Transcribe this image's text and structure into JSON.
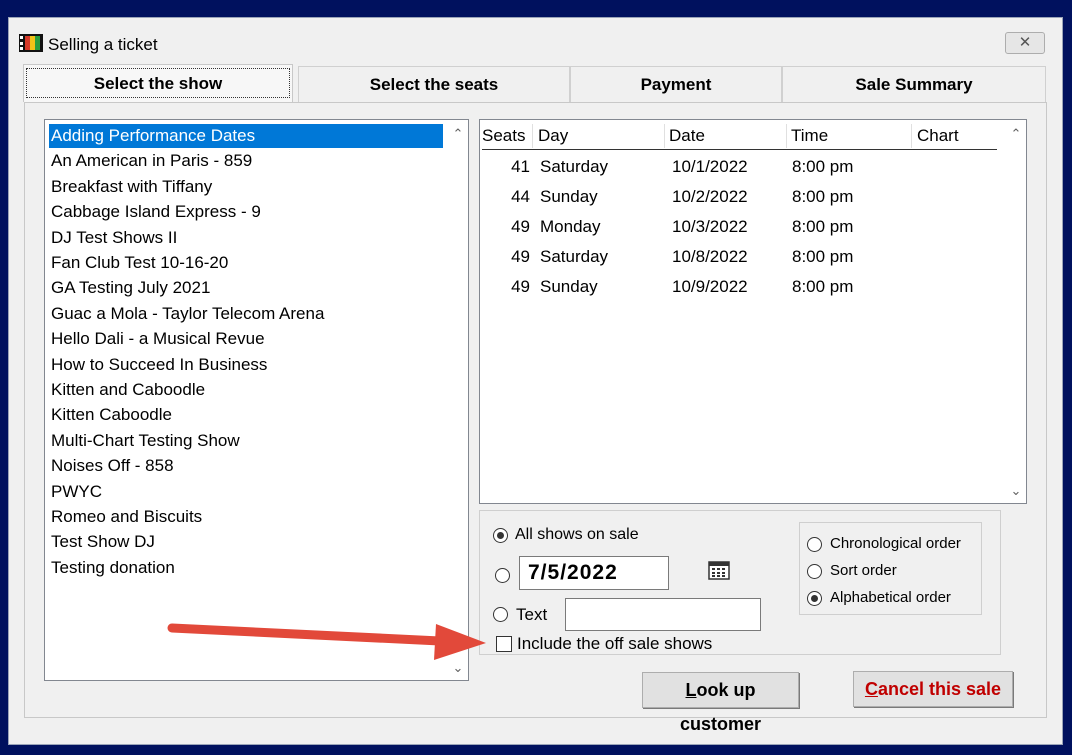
{
  "window": {
    "title": "Selling a ticket",
    "close_glyph": "✕"
  },
  "tabs": [
    {
      "label": "Select the show"
    },
    {
      "label": "Select the seats"
    },
    {
      "label": "Payment"
    },
    {
      "label": "Sale Summary"
    }
  ],
  "shows": [
    "Adding Performance Dates",
    "An American in Paris - 859",
    "Breakfast with Tiffany",
    "Cabbage Island Express - 9",
    "DJ Test Shows II",
    "Fan Club Test 10-16-20",
    "GA Testing July 2021",
    "Guac a Mola - Taylor Telecom Arena",
    "Hello Dali - a Musical Revue",
    "How to Succeed In Business",
    "Kitten and Caboodle",
    "Kitten Caboodle",
    "Multi-Chart Testing Show",
    "Noises Off - 858",
    "PWYC",
    "Romeo and Biscuits",
    "Test Show DJ",
    "Testing donation"
  ],
  "performances": {
    "columns": [
      "Seats",
      "Day",
      "Date",
      "Time",
      "Chart"
    ],
    "rows": [
      {
        "seats": "41",
        "day": "Saturday",
        "date": "10/1/2022",
        "time": "8:00 pm",
        "chart": ""
      },
      {
        "seats": "44",
        "day": "Sunday",
        "date": "10/2/2022",
        "time": "8:00 pm",
        "chart": ""
      },
      {
        "seats": "49",
        "day": "Monday",
        "date": "10/3/2022",
        "time": "8:00 pm",
        "chart": ""
      },
      {
        "seats": "49",
        "day": "Saturday",
        "date": "10/8/2022",
        "time": "8:00 pm",
        "chart": ""
      },
      {
        "seats": "49",
        "day": "Sunday",
        "date": "10/9/2022",
        "time": "8:00 pm",
        "chart": ""
      }
    ]
  },
  "filter": {
    "all_shows_label": "All shows on sale",
    "date_value": "7/5/2022",
    "text_label": "Text",
    "text_value": "",
    "include_off_sale_label": "Include the off sale shows"
  },
  "order": {
    "chronological_label": "Chronological order",
    "sort_label": "Sort order",
    "alphabetical_label": "Alphabetical order"
  },
  "buttons": {
    "lookup_mnemonic": "L",
    "lookup_rest": "ook up customer",
    "cancel_mnemonic": "C",
    "cancel_rest": "ancel this sale"
  },
  "colors": {
    "desktop": "#00115e",
    "selection": "#0078d7",
    "cancel_text": "#c00000",
    "annotation_arrow": "#e2493a"
  }
}
